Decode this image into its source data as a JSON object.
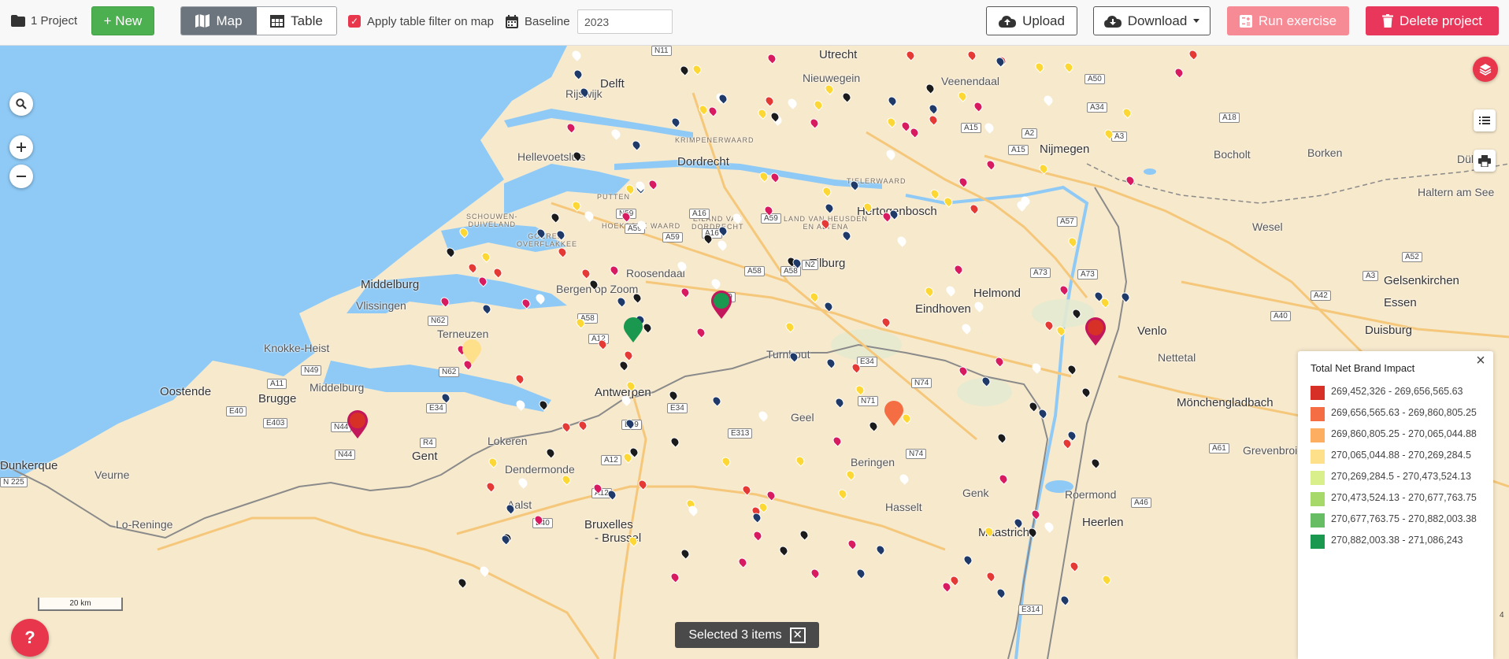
{
  "toolbar": {
    "project_count": "1 Project",
    "new_label": "+ New",
    "map_label": "Map",
    "table_label": "Table",
    "filter_label": "Apply table filter on map",
    "filter_checked": true,
    "baseline_label": "Baseline",
    "baseline_value": "2023",
    "upload_label": "Upload",
    "download_label": "Download",
    "run_label": "Run exercise",
    "delete_label": "Delete project"
  },
  "map": {
    "labels": {
      "middelburg": "Middelburg",
      "vlissingen": "Vlissingen",
      "knokke": "Knokke-Heist",
      "oostende": "Oostende",
      "brugge": "Brugge",
      "middelburg_be": "Middelburg",
      "terneuzen": "Terneuzen",
      "gent": "Gent",
      "lokeren": "Lokeren",
      "dendermonde": "Dendermonde",
      "aalst": "Aalst",
      "bruxelles": "Bruxelles",
      "brussel": "- Brussel",
      "antwerpen": "Antwerpen",
      "turnhout": "Turnhout",
      "geel": "Geel",
      "beringen": "Beringen",
      "hasselt": "Hasselt",
      "genk": "Genk",
      "maastricht": "Maastricht",
      "heerlen": "Heerlen",
      "roermond": "Roermond",
      "venlo": "Venlo",
      "monchengladbach": "Mönchengladbach",
      "duisburg": "Duisburg",
      "essen": "Essen",
      "gelsenkirchen": "Gelsenkirchen",
      "nettetal": "Nettetal",
      "wesel": "Wesel",
      "haltern": "Haltern am See",
      "bocholt": "Bocholt",
      "borken": "Borken",
      "dulmen": "Dülmen",
      "nijmegen": "Nijmegen",
      "hertogenbosch": "Hertogenbosch",
      "tilburg": "Tilburg",
      "eindhoven": "Eindhoven",
      "helmond": "Helmond",
      "roosendaal": "Roosendaal",
      "bergen_op_zoom": "Bergen op Zoom",
      "dordrecht": "Dordrecht",
      "hellevoetsluis": "Hellevoetsluis",
      "utrecht": "Utrecht",
      "veenendaal": "Veenendaal",
      "nieuwegein": "Nieuwegein",
      "rijswijk": "Rijswijk",
      "delft": "Delft",
      "dunkerque": "Dunkerque",
      "veurne": "Veurne",
      "lo_reninge": "Lo-Reninge",
      "grevenbroich": "Grevenbroich",
      "goeree": "GOEREE-\nOVERFLAKKEE",
      "schouwen": "SCHOUWEN-\nDUIVELAND",
      "hoeksche": "HOEKSCHE WAARD",
      "tielerwaard": "TIELERWAARD",
      "eiland": "EILAND VAN\nDORDRECHT",
      "altena": "LAND VAN HEUSDEN\nEN ALTENA",
      "krimpenerwaard": "KRIMPENERWAARD",
      "putten": "PUTTEN"
    },
    "roads": {
      "n11": "N11",
      "a50": "A50",
      "a34": "A34",
      "a18": "A18",
      "a3": "A3",
      "a15": "A15",
      "a15b": "A15",
      "a73": "A73",
      "a57": "A57",
      "a73b": "A73",
      "a52": "A52",
      "a42": "A42",
      "a40": "A40",
      "a3b": "A3",
      "n59": "N59",
      "a16": "A16",
      "a59": "A59",
      "a59b": "A59",
      "a16b": "A16",
      "a58": "A58",
      "a58b": "A58",
      "e19": "E19",
      "a58c": "A58",
      "a12": "A12",
      "n62": "N62",
      "n62b": "N62",
      "n49": "N49",
      "a11": "A11",
      "e34": "E34",
      "e34b": "E34",
      "e19b": "E19",
      "e313": "E313",
      "r4": "R4",
      "n44": "N44",
      "n44b": "N44",
      "e40": "E40",
      "e403": "E403",
      "a12b": "A12",
      "a12c": "A12",
      "e40b": "E40",
      "n225": "N 225",
      "e34c": "E34",
      "n71": "N71",
      "n74": "N74",
      "n74b": "N74",
      "e314": "E314",
      "a46": "A46",
      "a61": "A61",
      "n2": "N2",
      "a2": "A2"
    }
  },
  "legend": {
    "title": "Total Net Brand Impact",
    "items": [
      {
        "label": "269,452,326 - 269,656,565.63",
        "color": "#d73027"
      },
      {
        "label": "269,656,565.63 - 269,860,805.25",
        "color": "#f46d43"
      },
      {
        "label": "269,860,805.25 - 270,065,044.88",
        "color": "#fdae61"
      },
      {
        "label": "270,065,044.88 - 270,269,284.5",
        "color": "#fee08b"
      },
      {
        "label": "270,269,284.5 - 270,473,524.13",
        "color": "#d9ef8b"
      },
      {
        "label": "270,473,524.13 - 270,677,763.75",
        "color": "#a6d96a"
      },
      {
        "label": "270,677,763.75 - 270,882,003.38",
        "color": "#66bd63"
      },
      {
        "label": "270,882,003.38 - 271,086,243",
        "color": "#1a9850"
      }
    ]
  },
  "scale_label": "20 km",
  "selection": {
    "label": "Selected 3 items"
  },
  "help_label": "?",
  "edge_text": "4",
  "colors": {
    "accent": "#e8374d",
    "new_green": "#4caf50",
    "water": "#8fcaf6",
    "land": "#f7e9cc"
  }
}
